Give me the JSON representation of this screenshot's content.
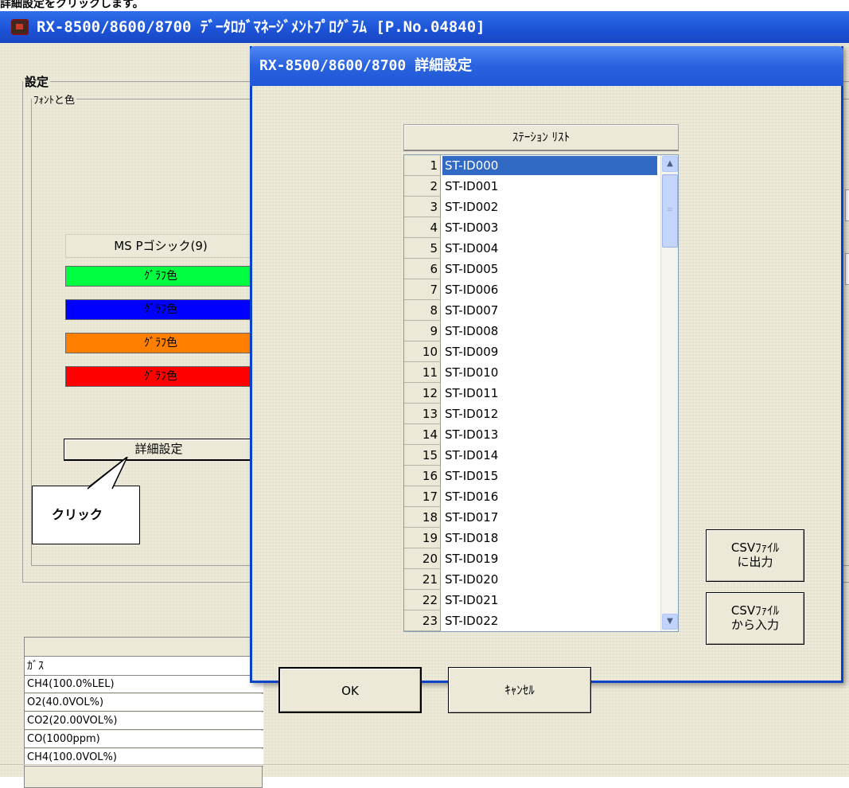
{
  "top_caption": "詳細設定をクリックします。",
  "main_window": {
    "title": "RX-8500/8600/8700 ﾃﾞｰﾀﾛｶﾞﾏﾈｰｼﾞﾒﾝﾄﾌﾟﾛｸﾞﾗﾑ [P.No.04840]",
    "settings_group": "設定",
    "fonts_colors_group": "ﾌｫﾝﾄと色",
    "font_button": "MS Pゴシック(9)",
    "color_buttons": [
      {
        "label": "ｸﾞﾗﾌ色",
        "color": "#00ff40"
      },
      {
        "label": "ｸﾞﾗﾌ色",
        "color": "#0000ff"
      },
      {
        "label": "ｸﾞﾗﾌ色",
        "color": "#ff8000"
      },
      {
        "label": "ｸﾞﾗﾌ色",
        "color": "#ff0000"
      }
    ],
    "detail_button": "詳細設定",
    "callout": "クリック",
    "gas_table": {
      "header": "ｶﾞｽ",
      "rows": [
        "CH4(100.0%LEL)",
        "O2(40.0VOL%)",
        "CO2(20.00VOL%)",
        "CO(1000ppm)",
        "CH4(100.0VOL%)"
      ]
    }
  },
  "dialog": {
    "title": "RX-8500/8600/8700 詳細設定",
    "list_header": "ｽﾃｰｼｮﾝ ﾘｽﾄ",
    "stations": [
      {
        "num": "1",
        "id": "ST-ID000"
      },
      {
        "num": "2",
        "id": "ST-ID001"
      },
      {
        "num": "3",
        "id": "ST-ID002"
      },
      {
        "num": "4",
        "id": "ST-ID003"
      },
      {
        "num": "5",
        "id": "ST-ID004"
      },
      {
        "num": "6",
        "id": "ST-ID005"
      },
      {
        "num": "7",
        "id": "ST-ID006"
      },
      {
        "num": "8",
        "id": "ST-ID007"
      },
      {
        "num": "9",
        "id": "ST-ID008"
      },
      {
        "num": "10",
        "id": "ST-ID009"
      },
      {
        "num": "11",
        "id": "ST-ID010"
      },
      {
        "num": "12",
        "id": "ST-ID011"
      },
      {
        "num": "13",
        "id": "ST-ID012"
      },
      {
        "num": "14",
        "id": "ST-ID013"
      },
      {
        "num": "15",
        "id": "ST-ID014"
      },
      {
        "num": "16",
        "id": "ST-ID015"
      },
      {
        "num": "17",
        "id": "ST-ID016"
      },
      {
        "num": "18",
        "id": "ST-ID017"
      },
      {
        "num": "19",
        "id": "ST-ID018"
      },
      {
        "num": "20",
        "id": "ST-ID019"
      },
      {
        "num": "21",
        "id": "ST-ID020"
      },
      {
        "num": "22",
        "id": "ST-ID021"
      },
      {
        "num": "23",
        "id": "ST-ID022"
      }
    ],
    "selected_index": 0,
    "csv_export_label": "CSVﾌｧｲﾙ\nに出力",
    "csv_import_label": "CSVﾌｧｲﾙ\nから入力",
    "ok_label": "OK",
    "cancel_label": "ｷｬﾝｾﾙ",
    "accent_color": "#316ac5"
  }
}
